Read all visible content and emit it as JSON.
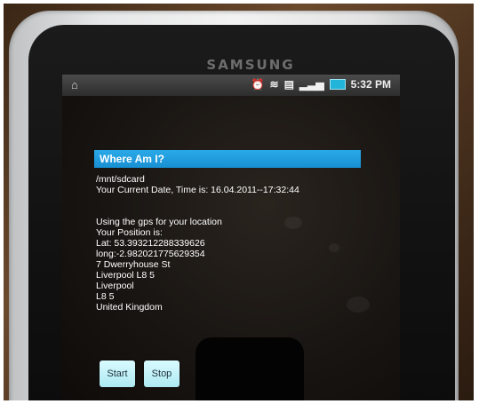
{
  "device": {
    "brand": "SAMSUNG"
  },
  "statusbar": {
    "time": "5:32 PM"
  },
  "app": {
    "title": "Where Am I?",
    "path": "/mnt/sdcard",
    "datetime_line": "Your Current Date, Time is: 16.04.2011--17:32:44",
    "lines": [
      "Using the gps for your location",
      "Your Position is:",
      "Lat: 53.393212288339626",
      "long:-2.982021775629354",
      "7 Dwerryhouse St",
      "Liverpool L8 5",
      "Liverpool",
      "L8 5",
      "United Kingdom"
    ],
    "buttons": {
      "start": "Start",
      "stop": "Stop"
    }
  },
  "icons": [
    "home-icon",
    "alarm-icon",
    "wifi-icon",
    "sd-card-icon",
    "signal-icon",
    "battery-icon"
  ],
  "colors": {
    "title_bar": "#1f9ee0",
    "button": "#c4f3fa",
    "battery": "#23b5d9"
  }
}
